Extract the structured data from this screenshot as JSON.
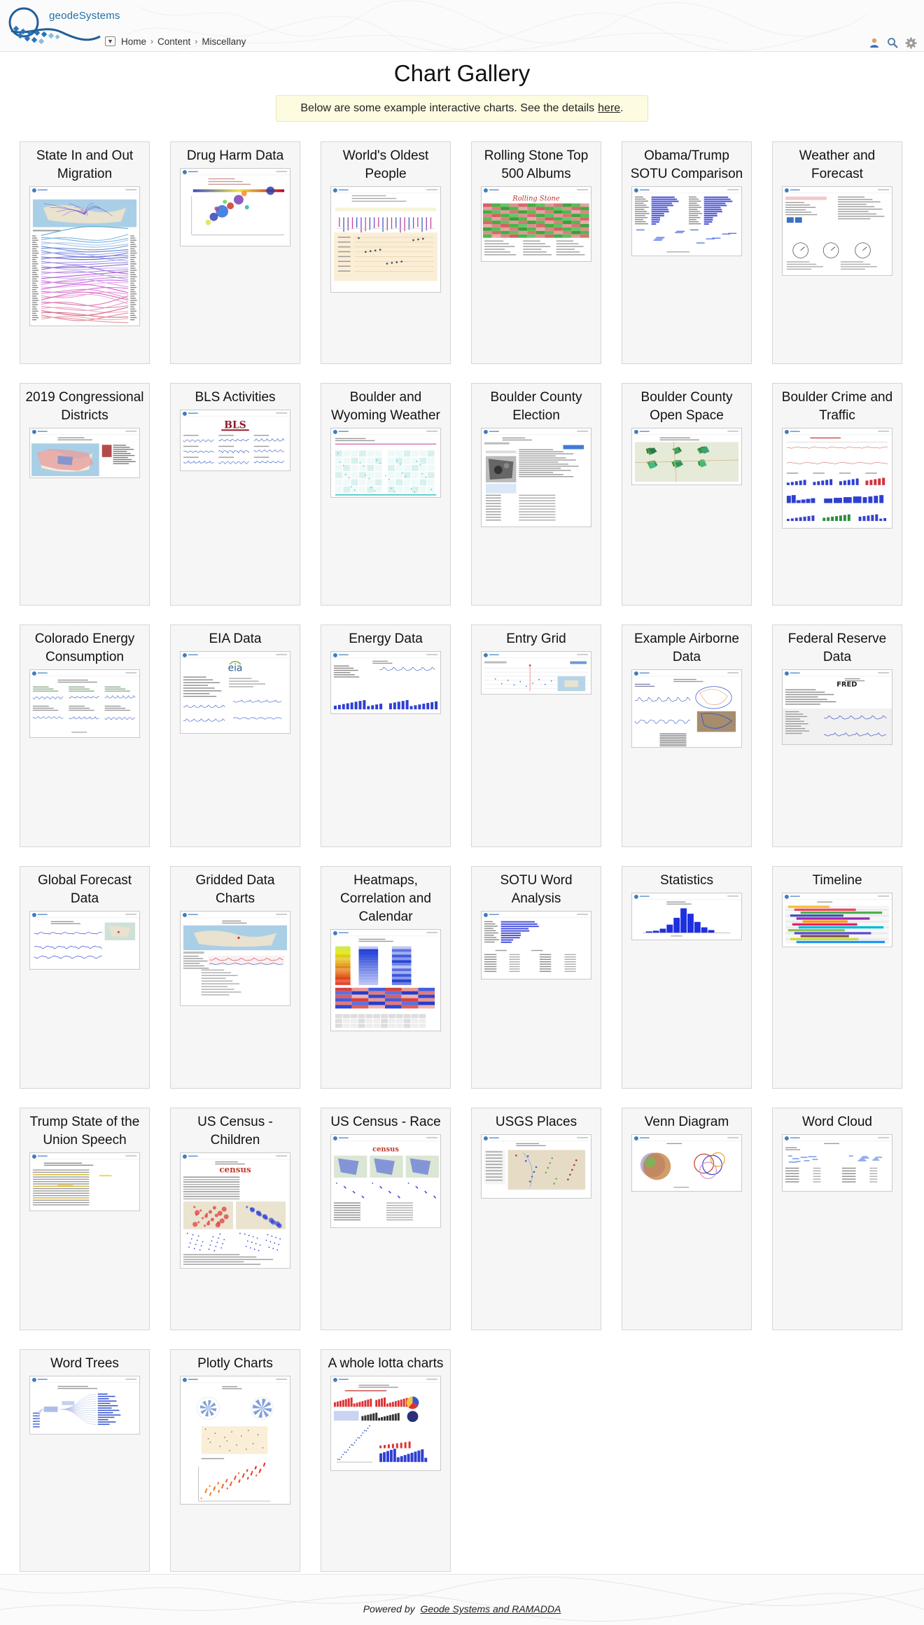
{
  "header": {
    "logo_text": "geodeSystems",
    "breadcrumb": [
      "Home",
      "Content",
      "Miscellany"
    ],
    "icons": [
      "user-icon",
      "search-icon",
      "gear-icon"
    ]
  },
  "page": {
    "title": "Chart Gallery",
    "intro_text": "Below are some example interactive charts. See the details",
    "intro_link": "here",
    "intro_end": "."
  },
  "gallery": [
    {
      "title": "State In and Out Migration",
      "thumb": "migration"
    },
    {
      "title": "Drug Harm Data",
      "thumb": "scatter"
    },
    {
      "title": "World's Oldest People",
      "thumb": "oldest"
    },
    {
      "title": "Rolling Stone Top 500 Albums",
      "thumb": "heat"
    },
    {
      "title": "Obama/Trump SOTU Comparison",
      "thumb": "bars2"
    },
    {
      "title": "Weather and Forecast",
      "thumb": "weather"
    },
    {
      "title": "2019 Congressional Districts",
      "thumb": "usmap"
    },
    {
      "title": "BLS Activities",
      "thumb": "bls"
    },
    {
      "title": "Boulder and Wyoming Weather",
      "thumb": "tiles"
    },
    {
      "title": "Boulder County Election",
      "thumb": "election"
    },
    {
      "title": "Boulder County Open Space",
      "thumb": "openspace"
    },
    {
      "title": "Boulder Crime and Traffic",
      "thumb": "crime"
    },
    {
      "title": "Colorado Energy Consumption",
      "thumb": "energy"
    },
    {
      "title": "EIA Data",
      "thumb": "eia"
    },
    {
      "title": "Energy Data",
      "thumb": "energydata"
    },
    {
      "title": "Entry Grid",
      "thumb": "entrygrid"
    },
    {
      "title": "Example Airborne Data",
      "thumb": "airborne"
    },
    {
      "title": "Federal Reserve Data",
      "thumb": "fred"
    },
    {
      "title": "Global Forecast Data",
      "thumb": "global"
    },
    {
      "title": "Gridded Data Charts",
      "thumb": "gridded"
    },
    {
      "title": "Heatmaps, Correlation and Calendar",
      "thumb": "heatmaps"
    },
    {
      "title": "SOTU Word Analysis",
      "thumb": "sotu"
    },
    {
      "title": "Statistics",
      "thumb": "histogram"
    },
    {
      "title": "Timeline",
      "thumb": "timeline"
    },
    {
      "title": "Trump State of the Union Speech",
      "thumb": "text"
    },
    {
      "title": "US Census - Children",
      "thumb": "census"
    },
    {
      "title": "US Census - Race",
      "thumb": "censusrace"
    },
    {
      "title": "USGS Places",
      "thumb": "usgs"
    },
    {
      "title": "Venn Diagram",
      "thumb": "venn"
    },
    {
      "title": "Word Cloud",
      "thumb": "wordcloud"
    },
    {
      "title": "Word Trees",
      "thumb": "wordtree"
    },
    {
      "title": "Plotly Charts",
      "thumb": "plotly"
    },
    {
      "title": "A whole lotta charts",
      "thumb": "lotta"
    }
  ],
  "footer": {
    "prefix": "Powered by",
    "link": "Geode Systems and RAMADDA"
  }
}
